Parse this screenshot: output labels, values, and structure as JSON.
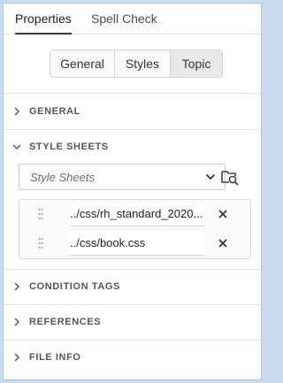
{
  "tabs": [
    {
      "label": "Properties",
      "active": true
    },
    {
      "label": "Spell Check",
      "active": false
    }
  ],
  "segmented": [
    {
      "label": "General",
      "selected": false
    },
    {
      "label": "Styles",
      "selected": false
    },
    {
      "label": "Topic",
      "selected": true
    }
  ],
  "sections": {
    "general": {
      "label": "GENERAL",
      "expanded": false
    },
    "style_sheets": {
      "label": "STYLE SHEETS",
      "expanded": true
    },
    "condition_tags": {
      "label": "CONDITION TAGS",
      "expanded": false
    },
    "references": {
      "label": "REFERENCES",
      "expanded": false
    },
    "file_info": {
      "label": "FILE INFO",
      "expanded": false
    }
  },
  "style_sheets": {
    "dropdown_placeholder": "Style Sheets",
    "files": [
      {
        "name": "../css/rh_standard_2020..."
      },
      {
        "name": "../css/book.css"
      }
    ]
  },
  "icons": {
    "browse": "folder-search-icon",
    "remove": "close-icon",
    "drag": "drag-handle-icon"
  },
  "colors": {
    "frame": "#c9dcef",
    "selected_segment": "#e8e8e8"
  }
}
